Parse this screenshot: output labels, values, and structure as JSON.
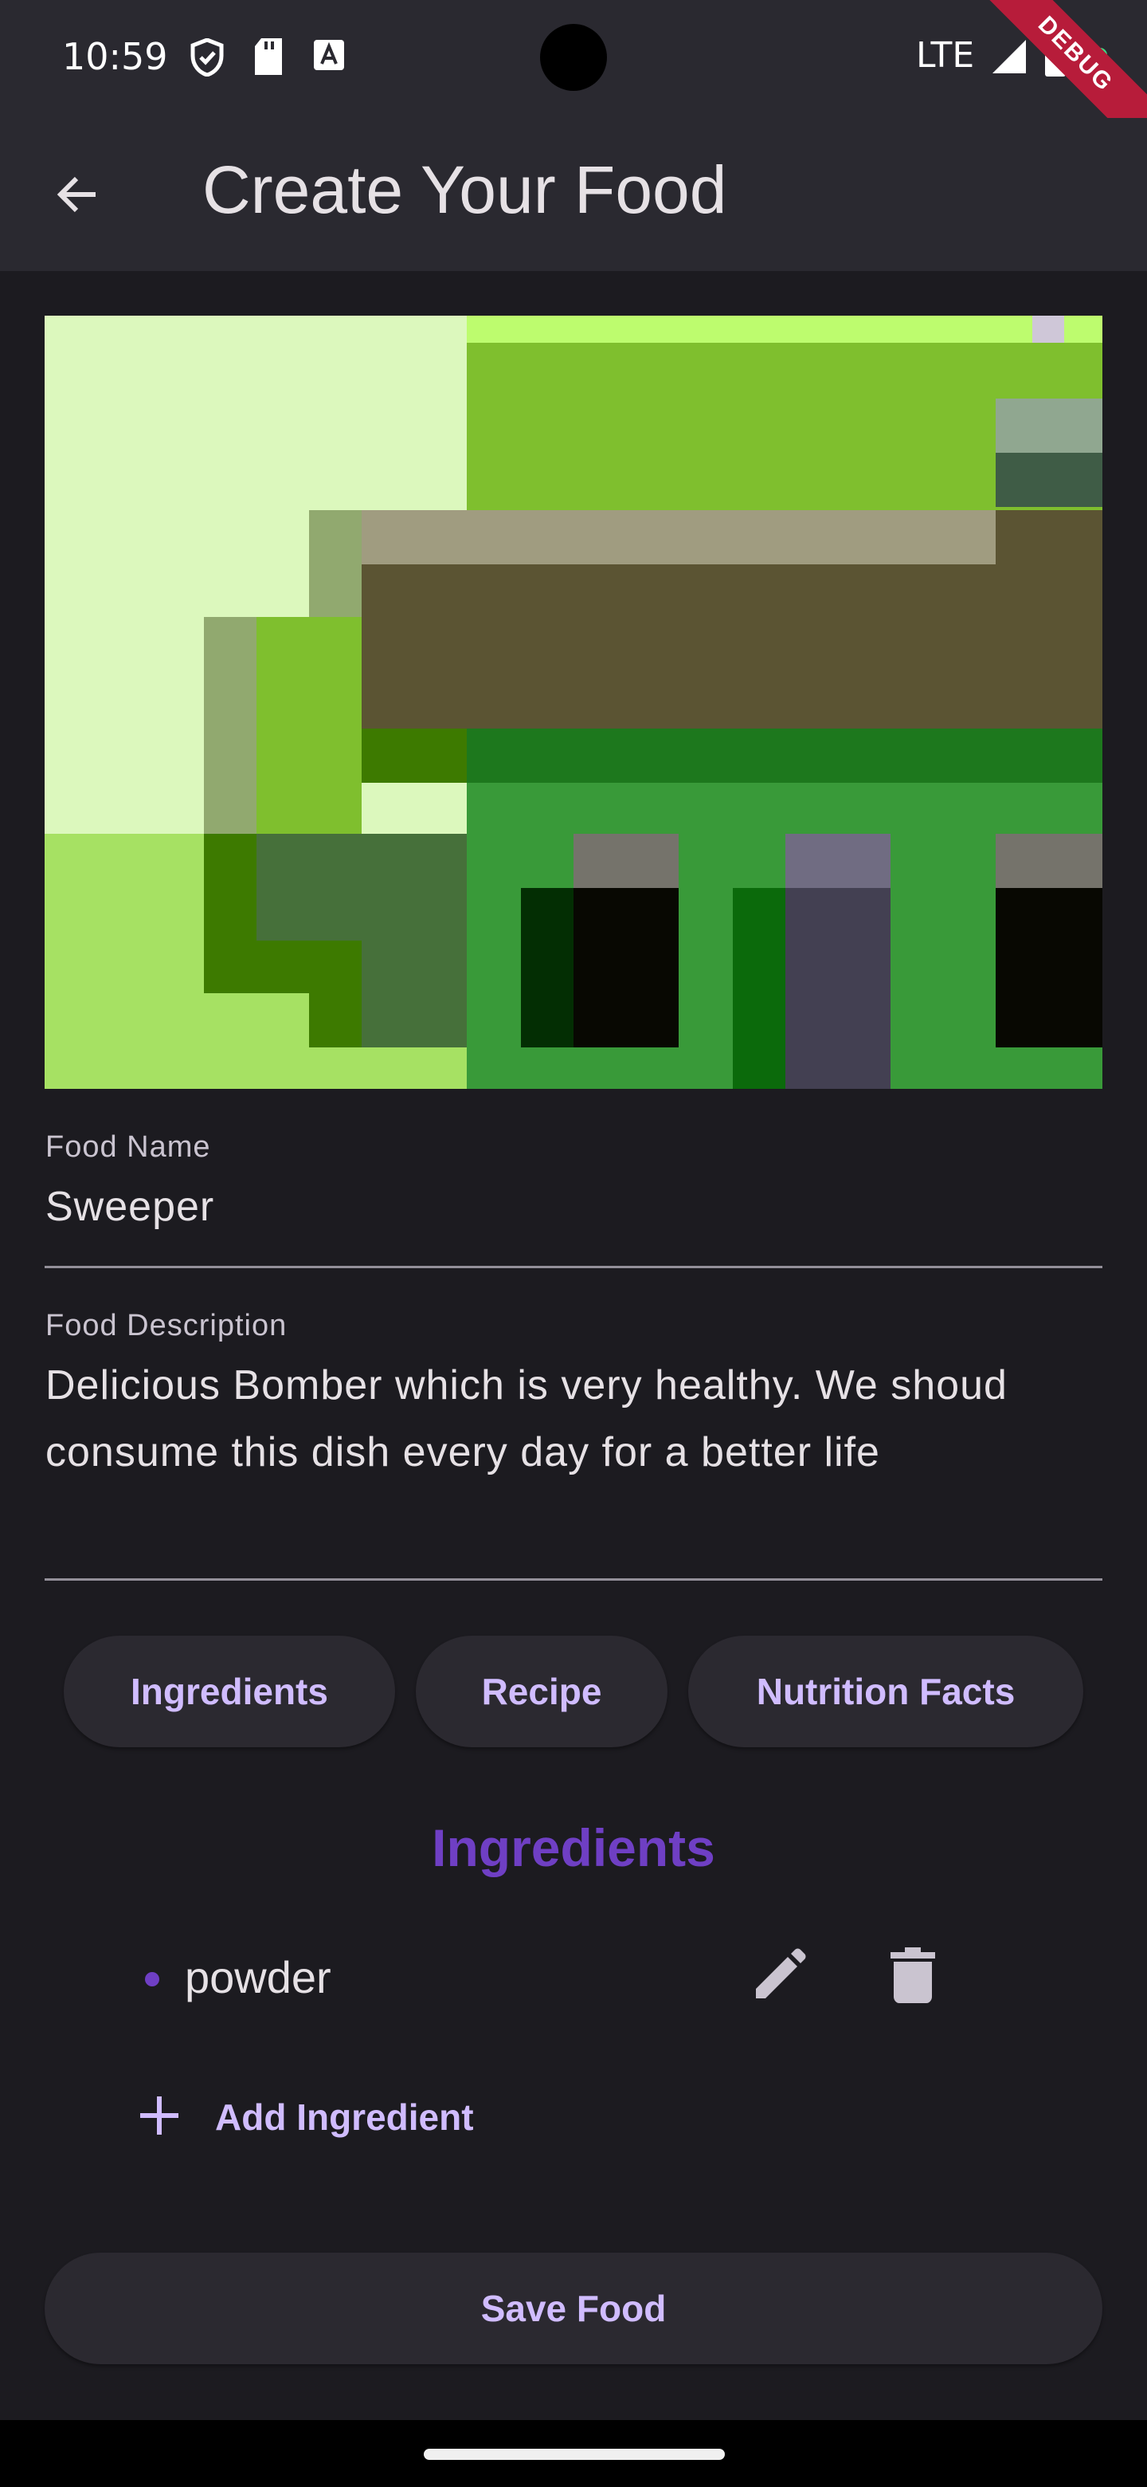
{
  "status_bar": {
    "time": "10:59",
    "network": "LTE",
    "icons": [
      "shield-icon",
      "sd-card-icon",
      "font-icon",
      "signal-icon",
      "battery-icon"
    ]
  },
  "debug_banner": "DEBUG",
  "app_bar": {
    "title": "Create Your Food",
    "back_icon": "arrow-back-icon"
  },
  "food_image": {
    "alt": "pixelated food image"
  },
  "form": {
    "name_label": "Food Name",
    "name_value": "Sweeper",
    "description_label": "Food Description",
    "description_value": "Delicious Bomber which is very healthy. We shoud consume this dish every day for a better life"
  },
  "tabs": [
    {
      "label": "Ingredients"
    },
    {
      "label": "Recipe"
    },
    {
      "label": "Nutrition Facts"
    }
  ],
  "ingredients": {
    "heading": "Ingredients",
    "items": [
      {
        "name": "powder"
      }
    ],
    "add_label": "Add Ingredient"
  },
  "save_label": "Save Food",
  "colors": {
    "accent": "#d0bcff",
    "heading": "#6f3fc4",
    "surface": "#2b2930",
    "background": "#1c1b20"
  }
}
